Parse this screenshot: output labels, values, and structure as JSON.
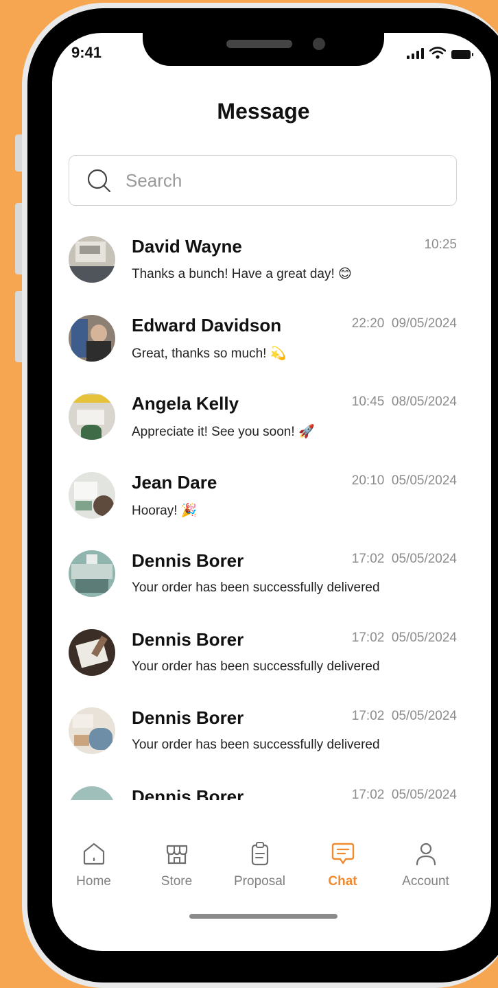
{
  "status": {
    "time": "9:41"
  },
  "header": {
    "title": "Message"
  },
  "search": {
    "placeholder": "Search"
  },
  "conversations": [
    {
      "name": "David Wayne",
      "time": "10:25",
      "date": "",
      "preview": "Thanks a bunch! Have a great day!",
      "emoji": "😊"
    },
    {
      "name": "Edward Davidson",
      "time": "22:20",
      "date": "09/05/2024",
      "preview": "Great, thanks so much!",
      "emoji": "💫"
    },
    {
      "name": "Angela Kelly",
      "time": "10:45",
      "date": "08/05/2024",
      "preview": "Appreciate it! See you soon!",
      "emoji": "🚀"
    },
    {
      "name": "Jean Dare",
      "time": "20:10",
      "date": "05/05/2024",
      "preview": "Hooray!",
      "emoji": "🎉"
    },
    {
      "name": "Dennis Borer",
      "time": "17:02",
      "date": "05/05/2024",
      "preview": "Your order has been successfully delivered",
      "emoji": ""
    },
    {
      "name": "Dennis Borer",
      "time": "17:02",
      "date": "05/05/2024",
      "preview": "Your order has been successfully delivered",
      "emoji": ""
    },
    {
      "name": "Dennis Borer",
      "time": "17:02",
      "date": "05/05/2024",
      "preview": "Your order has been successfully delivered",
      "emoji": ""
    },
    {
      "name": "Dennis Borer",
      "time": "17:02",
      "date": "05/05/2024",
      "preview": "",
      "emoji": ""
    }
  ],
  "tabs": [
    {
      "label": "Home",
      "icon": "home-icon",
      "active": false
    },
    {
      "label": "Store",
      "icon": "store-icon",
      "active": false
    },
    {
      "label": "Proposal",
      "icon": "clipboard-icon",
      "active": false
    },
    {
      "label": "Chat",
      "icon": "chat-icon",
      "active": true
    },
    {
      "label": "Account",
      "icon": "user-icon",
      "active": false
    }
  ],
  "colors": {
    "background": "#F6A550",
    "accent": "#F08A2E",
    "muted": "#8C8C8C"
  }
}
